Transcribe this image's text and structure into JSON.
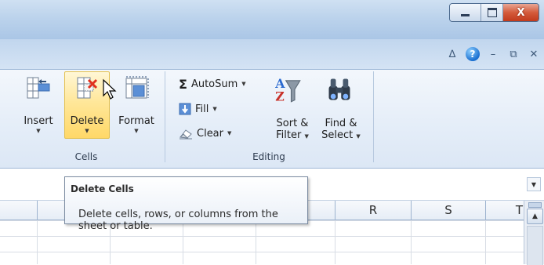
{
  "window": {
    "minimize_icon": "minimize-icon",
    "maximize_icon": "maximize-icon",
    "close_glyph": "X"
  },
  "ribbon_controls": {
    "minimize_ribbon_glyph": "∆",
    "help_glyph": "?",
    "doc_minimize_glyph": "–",
    "doc_restore_glyph": "⧉",
    "doc_close_glyph": "✕"
  },
  "cells_group": {
    "label": "Cells",
    "insert_label": "Insert",
    "delete_label": "Delete",
    "format_label": "Format",
    "dropdown_glyph": "▼"
  },
  "editing_group": {
    "label": "Editing",
    "autosum_symbol": "Σ",
    "autosum_label": "AutoSum",
    "fill_label": "Fill",
    "clear_label": "Clear",
    "sort_filter_line1": "Sort &",
    "sort_filter_line2": "Filter",
    "find_select_line1": "Find &",
    "find_select_line2": "Select",
    "dropdown_glyph": "▼"
  },
  "formula_bar": {
    "dropdown_glyph": "▼"
  },
  "columns": {
    "r": "R",
    "s": "S",
    "t": "T"
  },
  "scrollbar": {
    "up_glyph": "▲"
  },
  "tooltip": {
    "title": "Delete Cells",
    "body": "Delete cells, rows, or columns from the sheet or table."
  },
  "colors": {
    "hover_button": "#ffe79a",
    "ribbon_bg": "#e4edf8",
    "close_button": "#d45a3b"
  }
}
